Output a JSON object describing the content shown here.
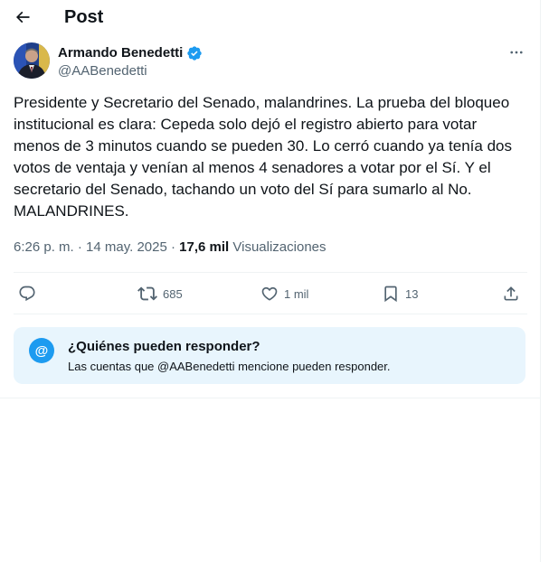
{
  "header": {
    "title": "Post",
    "back_icon": "arrow-left-icon"
  },
  "author": {
    "name": "Armando Benedetti",
    "handle": "@AABenedetti",
    "verified": true,
    "verified_color": "#1d9bf0",
    "more_icon": "more-horizontal-icon"
  },
  "tweet": {
    "text": "Presidente y Secretario del Senado, malandrines. La prueba del bloqueo\ninstitucional es clara: Cepeda solo dejó el registro abierto para votar\nmenos de 3 minutos cuando se pueden 30. Lo cerró cuando ya tenía dos\nvotos de ventaja y venían al menos 4 senadores a votar por el Sí. Y el\nsecretario del Senado, tachando un voto del Sí para sumarlo al No.\nMALANDRINES.",
    "time": "6:26 p. m.",
    "separator": "·",
    "date": "14 may. 2025",
    "views_count": "17,6 mil",
    "views_label": "Visualizaciones"
  },
  "actions": {
    "reply": {
      "icon": "reply-icon",
      "count": ""
    },
    "retweet": {
      "icon": "retweet-icon",
      "count": "685"
    },
    "like": {
      "icon": "heart-icon",
      "count": "1 mil"
    },
    "bookmark": {
      "icon": "bookmark-icon",
      "count": "13"
    },
    "share": {
      "icon": "share-icon"
    }
  },
  "reply_restriction": {
    "icon": "at-icon",
    "icon_glyph": "@",
    "title": "¿Quiénes pueden responder?",
    "subtitle": "Las cuentas que @AABenedetti mencione pueden responder."
  },
  "colors": {
    "text_primary": "#0f1419",
    "text_secondary": "#536471",
    "accent": "#1d9bf0",
    "card_background": "#e8f5fd"
  }
}
